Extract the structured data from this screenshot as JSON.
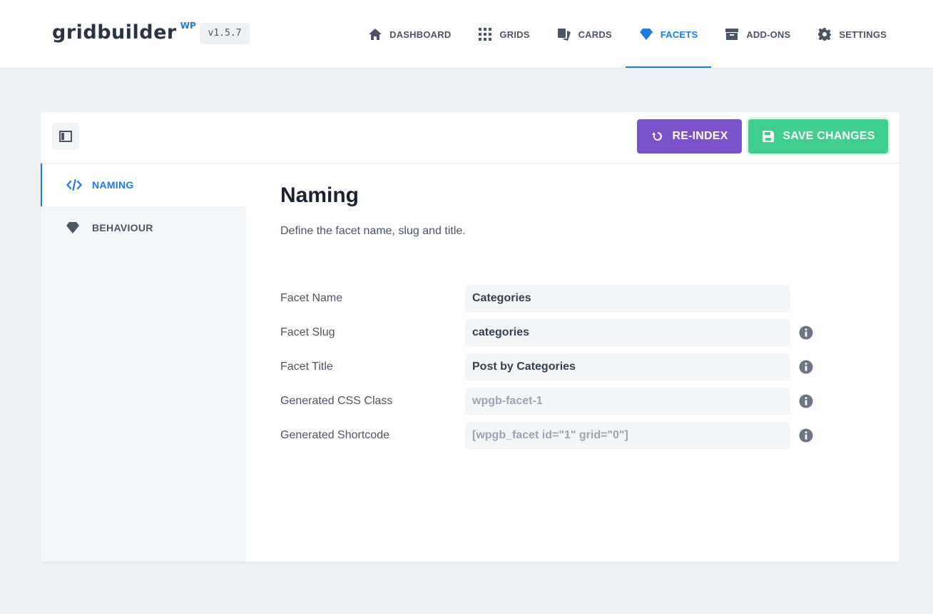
{
  "header": {
    "logo_text": "gridbuilder",
    "logo_badge": "WP",
    "version": "v1.5.7",
    "nav": [
      {
        "label": "DASHBOARD",
        "icon": "home-icon"
      },
      {
        "label": "GRIDS",
        "icon": "grid-icon"
      },
      {
        "label": "CARDS",
        "icon": "cards-icon"
      },
      {
        "label": "FACETS",
        "icon": "diamond-icon",
        "active": true
      },
      {
        "label": "ADD-ONS",
        "icon": "archive-icon"
      },
      {
        "label": "SETTINGS",
        "icon": "gear-icon"
      }
    ]
  },
  "toolbar": {
    "reindex_label": "RE-INDEX",
    "save_label": "SAVE CHANGES"
  },
  "sidebar": {
    "items": [
      {
        "label": "NAMING",
        "icon": "code-icon",
        "active": true
      },
      {
        "label": "BEHAVIOUR",
        "icon": "diamond-icon"
      }
    ]
  },
  "main": {
    "title": "Naming",
    "description": "Define the facet name, slug and title.",
    "fields": [
      {
        "label": "Facet Name",
        "value": "Categories",
        "info": false
      },
      {
        "label": "Facet Slug",
        "value": "categories",
        "info": true
      },
      {
        "label": "Facet Title",
        "value": "Post by Categories",
        "info": true
      },
      {
        "label": "Generated CSS Class",
        "value": "wpgb-facet-1",
        "info": true,
        "readonly": true
      },
      {
        "label": "Generated Shortcode",
        "value": "[wpgb_facet id=\"1\" grid=\"0\"]",
        "info": true,
        "readonly": true
      }
    ]
  },
  "colors": {
    "accent": "#1e7be4",
    "reindex": "#7c52cc",
    "save": "#3ecf8e",
    "background": "#eef1f4"
  }
}
